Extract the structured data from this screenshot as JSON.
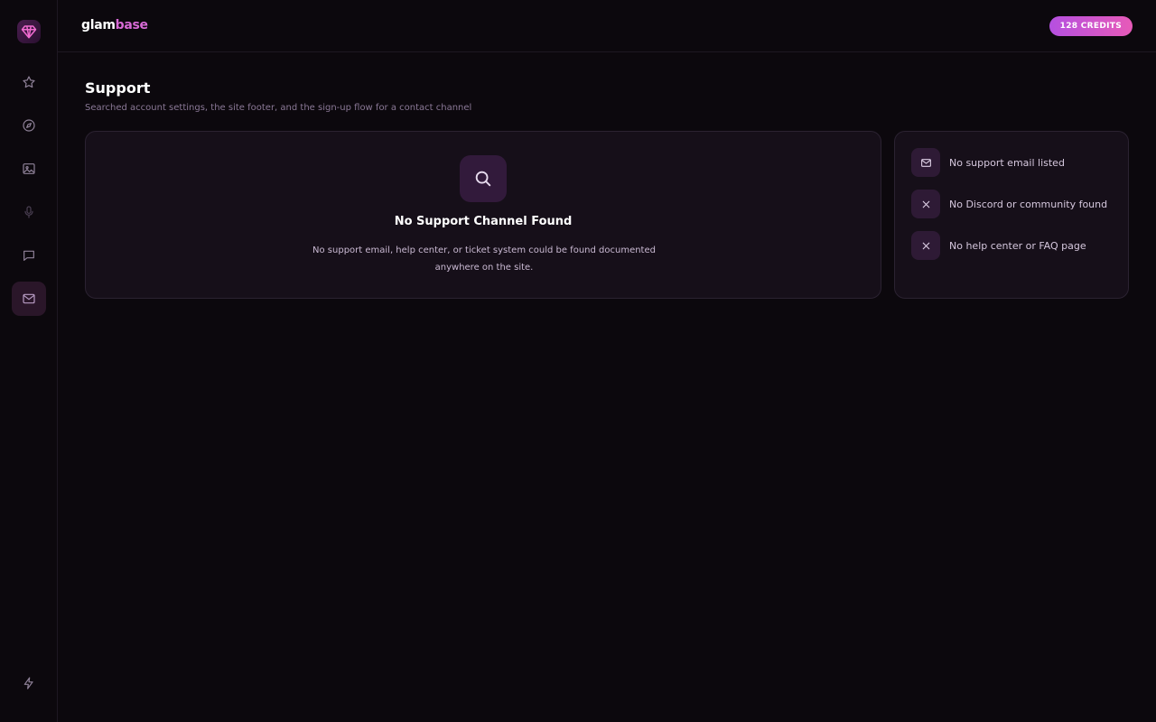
{
  "brand": {
    "part1": "glam",
    "part2": "base"
  },
  "header": {
    "credits_label": "128 CREDITS"
  },
  "sidebar": {
    "logo_icon": "diamond-heart-icon",
    "items": [
      {
        "name": "favorites",
        "icon": "star-icon",
        "active": false
      },
      {
        "name": "explore",
        "icon": "compass-icon",
        "active": false
      },
      {
        "name": "gallery",
        "icon": "image-icon",
        "active": false
      },
      {
        "name": "voice",
        "icon": "microphone-icon",
        "active": false
      },
      {
        "name": "chat",
        "icon": "chat-icon",
        "active": false
      },
      {
        "name": "support",
        "icon": "mail-icon",
        "active": true
      }
    ],
    "bottom_icon": "lightning-icon"
  },
  "page": {
    "title": "Support",
    "subtitle": "Searched account settings, the site footer, and the sign-up flow for a contact channel"
  },
  "empty_state": {
    "icon": "search-icon",
    "title": "No Support Channel Found",
    "description": "No support email, help center, or ticket system could be found documented anywhere on the site."
  },
  "findings": [
    {
      "icon": "mail-icon",
      "label": "No support email listed"
    },
    {
      "icon": "x-icon",
      "label": "No Discord or community found"
    },
    {
      "icon": "x-icon",
      "label": "No help center or FAQ page"
    }
  ],
  "colors": {
    "background": "#0c080d",
    "card": "#160f19",
    "accent_pink": "#d86ad6",
    "credits_gradient_start": "#b550e0",
    "credits_gradient_end": "#e75ab8"
  }
}
